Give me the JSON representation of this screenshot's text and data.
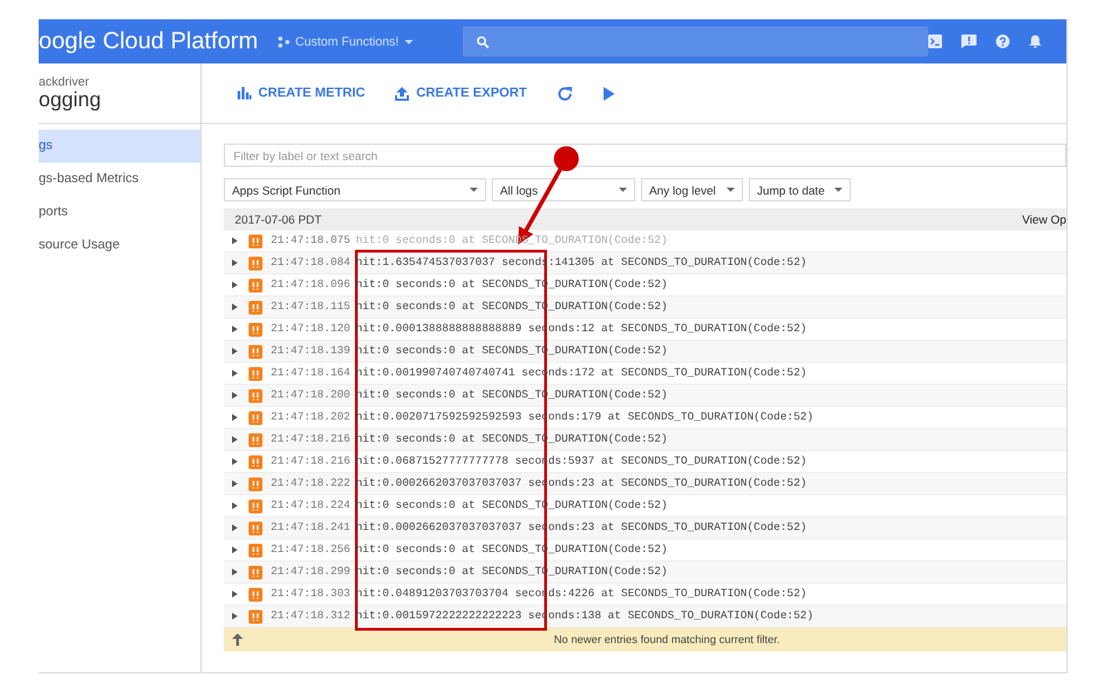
{
  "header": {
    "brand": "oogle Cloud Platform",
    "project": "Custom Functions!"
  },
  "sidebar": {
    "product": "ackdriver",
    "title": "ogging",
    "items": [
      {
        "label": "gs",
        "selected": true
      },
      {
        "label": "gs-based Metrics",
        "selected": false
      },
      {
        "label": "ports",
        "selected": false
      },
      {
        "label": "source Usage",
        "selected": false
      }
    ]
  },
  "toolbar": {
    "buttons": [
      {
        "kind": "metric",
        "label": "CREATE METRIC"
      },
      {
        "kind": "export",
        "label": "CREATE EXPORT"
      }
    ]
  },
  "filter": {
    "placeholder": "Filter by label or text search"
  },
  "dropdowns": [
    "Apps Script Function",
    "All logs",
    "Any log level",
    "Jump to date"
  ],
  "log": {
    "date": "2017-07-06 PDT",
    "column_3": "View Op",
    "rows": [
      {
        "time": "21:47:18.075",
        "message": "hit:0 seconds:0 at SECONDS_TO_DURATION(Code:52)",
        "partial": true
      },
      {
        "time": "21:47:18.084",
        "message": "hit:1.635474537037037 seconds:141305 at SECONDS_TO_DURATION(Code:52)",
        "partial": false
      },
      {
        "time": "21:47:18.096",
        "message": "hit:0 seconds:0 at SECONDS_TO_DURATION(Code:52)",
        "partial": false
      },
      {
        "time": "21:47:18.115",
        "message": "hit:0 seconds:0 at SECONDS_TO_DURATION(Code:52)",
        "partial": false
      },
      {
        "time": "21:47:18.120",
        "message": "hit:0.0001388888888888889 seconds:12 at SECONDS_TO_DURATION(Code:52)",
        "partial": false
      },
      {
        "time": "21:47:18.139",
        "message": "hit:0 seconds:0 at SECONDS_TO_DURATION(Code:52)",
        "partial": false
      },
      {
        "time": "21:47:18.164",
        "message": "hit:0.001990740740740741 seconds:172 at SECONDS_TO_DURATION(Code:52)",
        "partial": false
      },
      {
        "time": "21:47:18.200",
        "message": "hit:0 seconds:0 at SECONDS_TO_DURATION(Code:52)",
        "partial": false
      },
      {
        "time": "21:47:18.202",
        "message": "hit:0.0020717592592592593 seconds:179 at SECONDS_TO_DURATION(Code:52)",
        "partial": false
      },
      {
        "time": "21:47:18.216",
        "message": "hit:0 seconds:0 at SECONDS_TO_DURATION(Code:52)",
        "partial": false
      },
      {
        "time": "21:47:18.216",
        "message": "hit:0.06871527777777778 seconds:5937 at SECONDS_TO_DURATION(Code:52)",
        "partial": false
      },
      {
        "time": "21:47:18.222",
        "message": "hit:0.0002662037037037037 seconds:23 at SECONDS_TO_DURATION(Code:52)",
        "partial": false
      },
      {
        "time": "21:47:18.224",
        "message": "hit:0 seconds:0 at SECONDS_TO_DURATION(Code:52)",
        "partial": false
      },
      {
        "time": "21:47:18.241",
        "message": "hit:0.0002662037037037037 seconds:23 at SECONDS_TO_DURATION(Code:52)",
        "partial": false
      },
      {
        "time": "21:47:18.256",
        "message": "hit:0 seconds:0 at SECONDS_TO_DURATION(Code:52)",
        "partial": false
      },
      {
        "time": "21:47:18.299",
        "message": "hit:0 seconds:0 at SECONDS_TO_DURATION(Code:52)",
        "partial": false
      },
      {
        "time": "21:47:18.303",
        "message": "hit:0.04891203703703704 seconds:4226 at SECONDS_TO_DURATION(Code:52)",
        "partial": false
      },
      {
        "time": "21:47:18.312",
        "message": "hit:0.0015972222222222223 seconds:138 at SECONDS_TO_DURATION(Code:52)",
        "partial": false
      }
    ],
    "notice": "No newer entries found matching current filter."
  }
}
